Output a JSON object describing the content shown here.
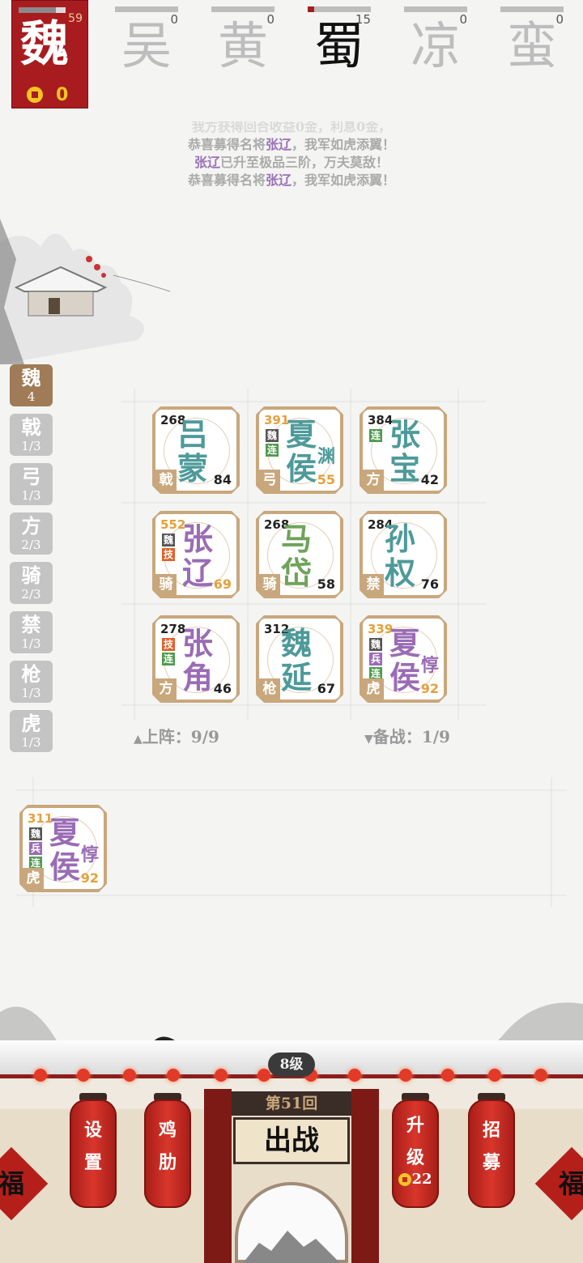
{
  "player": {
    "faction_char": "魏",
    "progress": 0.8,
    "progress_value": "59",
    "coins": "0"
  },
  "factions": [
    {
      "char": "吴",
      "value": "0",
      "progress": 0,
      "active": false
    },
    {
      "char": "黄",
      "value": "0",
      "progress": 0,
      "active": false
    },
    {
      "char": "蜀",
      "value": "15",
      "progress": 0.1,
      "active": true
    },
    {
      "char": "凉",
      "value": "0",
      "progress": 0,
      "active": false
    },
    {
      "char": "蛮",
      "value": "0",
      "progress": 0,
      "active": false
    }
  ],
  "messages": {
    "line0": "我方获得回合收益0金，利息0金，",
    "line1_a": "恭喜募得名将",
    "line1_hl": "张辽",
    "line1_b": "，我军如虎添翼！",
    "line2_hl": "张辽",
    "line2_b": "已升至极品三阶，万夫莫敌！",
    "line3_a": "恭喜募得名将",
    "line3_hl": "张辽",
    "line3_b": "，我军如虎添翼！"
  },
  "categories": [
    {
      "name": "魏",
      "count": "4",
      "active": true
    },
    {
      "name": "戟",
      "count": "1/3"
    },
    {
      "name": "弓",
      "count": "1/3"
    },
    {
      "name": "方",
      "count": "2/3"
    },
    {
      "name": "骑",
      "count": "2/3"
    },
    {
      "name": "禁",
      "count": "1/3"
    },
    {
      "name": "枪",
      "count": "1/3"
    },
    {
      "name": "虎",
      "count": "1/3"
    }
  ],
  "generals": [
    {
      "n1": "吕",
      "n2": "蒙",
      "power": "268",
      "type": "戟",
      "level": "84",
      "color": "#4e9a9a"
    },
    {
      "n1": "夏",
      "n2": "侯",
      "extra": "渊",
      "power": "391",
      "type": "弓",
      "level": "55",
      "color": "#4e9a9a",
      "gold": true,
      "tags": [
        "魏",
        "连"
      ]
    },
    {
      "n1": "张",
      "n2": "宝",
      "power": "384",
      "type": "方",
      "level": "42",
      "color": "#4e9a9a",
      "tags": [
        "连"
      ]
    },
    {
      "n1": "张",
      "n2": "辽",
      "power": "552",
      "type": "骑",
      "level": "69",
      "color": "#9a6cb5",
      "gold": true,
      "tags": [
        "魏",
        "技"
      ]
    },
    {
      "n1": "马",
      "n2": "岱",
      "power": "268",
      "type": "骑",
      "level": "58",
      "color": "#6fa35a"
    },
    {
      "n1": "孙",
      "n2": "权",
      "power": "284",
      "type": "禁",
      "level": "76",
      "color": "#4e9a9a"
    },
    {
      "n1": "张",
      "n2": "角",
      "power": "278",
      "type": "方",
      "level": "46",
      "color": "#9a6cb5",
      "tags": [
        "技",
        "连"
      ]
    },
    {
      "n1": "魏",
      "n2": "延",
      "power": "312",
      "type": "枪",
      "level": "67",
      "color": "#4e9a9a"
    },
    {
      "n1": "夏",
      "n2": "侯",
      "extra": "惇",
      "power": "339",
      "type": "虎",
      "level": "92",
      "color": "#9a6cb5",
      "gold": true,
      "tags": [
        "魏",
        "兵",
        "连"
      ]
    }
  ],
  "onstage_label": "上阵：9/9",
  "reserve_label": "备战：1/9",
  "reserve": [
    {
      "n1": "夏",
      "n2": "侯",
      "extra": "惇",
      "power": "311",
      "type": "虎",
      "level": "92",
      "color": "#9a6cb5",
      "gold": true,
      "tags": [
        "魏",
        "兵",
        "连"
      ]
    }
  ],
  "bottom": {
    "level": "8级",
    "round": "第51回",
    "battle": "出战",
    "settings": [
      "设",
      "置"
    ],
    "chicken": [
      "鸡",
      "肋"
    ],
    "upgrade": [
      "升",
      "级"
    ],
    "upgrade_cost": "22",
    "recruit": [
      "招",
      "募"
    ],
    "fu": "福"
  }
}
